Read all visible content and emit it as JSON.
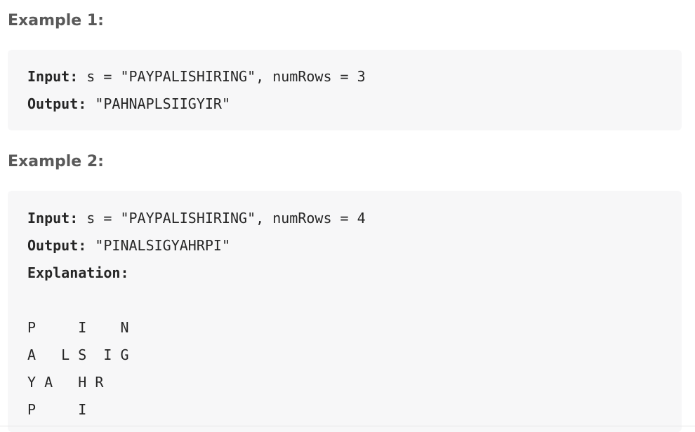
{
  "example1": {
    "heading": "Example 1:",
    "input_label": "Input:",
    "input_value": " s = \"PAYPALISHIRING\", numRows = 3",
    "output_label": "Output:",
    "output_value": " \"PAHNAPLSIIGYIR\""
  },
  "example2": {
    "heading": "Example 2:",
    "input_label": "Input:",
    "input_value": " s = \"PAYPALISHIRING\", numRows = 4",
    "output_label": "Output:",
    "output_value": " \"PINALSIGYAHRPI\"",
    "explanation_label": "Explanation:",
    "zigzag_rows": [
      "P     I    N",
      "A   L S  I G",
      "Y A   H R",
      "P     I"
    ]
  }
}
